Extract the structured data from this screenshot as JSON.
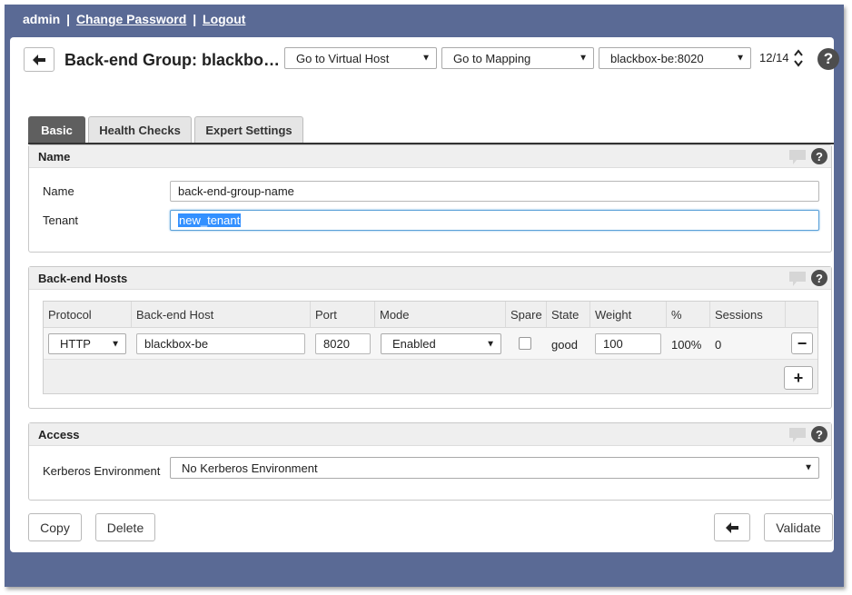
{
  "topbar": {
    "user": "admin",
    "separator": "|",
    "change_password": "Change Password",
    "logout": "Logout"
  },
  "header": {
    "title": "Back-end Group: blackbox-be",
    "virtual_host_select": "Go to Virtual Host",
    "mapping_select": "Go to Mapping",
    "item_select": "blackbox-be:8020",
    "counter": "12/14",
    "help": "?"
  },
  "tabs": [
    {
      "label": "Basic",
      "active": true
    },
    {
      "label": "Health Checks",
      "active": false
    },
    {
      "label": "Expert Settings",
      "active": false
    }
  ],
  "name_section": {
    "title": "Name",
    "help": "?",
    "name_label": "Name",
    "name_value": "back-end-group-name",
    "tenant_label": "Tenant",
    "tenant_value": "new_tenant"
  },
  "hosts_section": {
    "title": "Back-end Hosts",
    "help": "?",
    "columns": [
      "Protocol",
      "Back-end Host",
      "Port",
      "Mode",
      "Spare",
      "State",
      "Weight",
      "%",
      "Sessions"
    ],
    "row": {
      "protocol": "HTTP",
      "host": "blackbox-be",
      "port": "8020",
      "mode": "Enabled",
      "spare": false,
      "state": "good",
      "weight": "100",
      "percent": "100%",
      "sessions": "0"
    },
    "remove_label": "−",
    "add_label": "+"
  },
  "access_section": {
    "title": "Access",
    "help": "?",
    "kerberos_label": "Kerberos Environment",
    "kerberos_value": "No Kerberos Environment"
  },
  "footer": {
    "copy": "Copy",
    "delete": "Delete",
    "validate": "Validate"
  },
  "colors": {
    "frame": "#5a6a95",
    "tab_active": "#5f5f5f",
    "help_icon": "#4d4d4d",
    "focus": "#5aa0d8"
  }
}
